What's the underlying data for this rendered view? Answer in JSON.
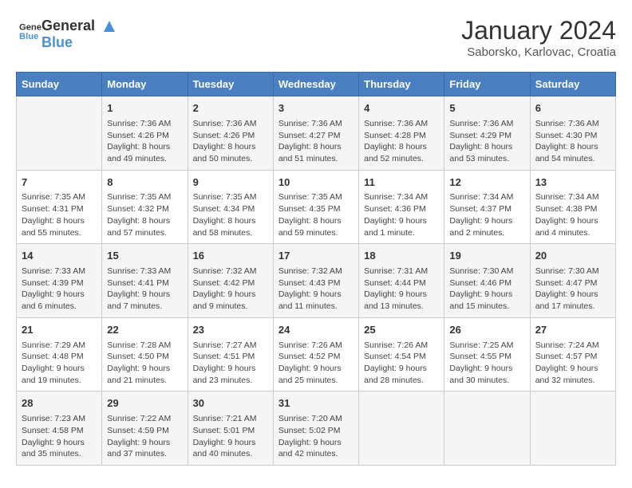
{
  "logo": {
    "line1": "General",
    "line2": "Blue"
  },
  "title": "January 2024",
  "subtitle": "Saborsko, Karlovac, Croatia",
  "headers": [
    "Sunday",
    "Monday",
    "Tuesday",
    "Wednesday",
    "Thursday",
    "Friday",
    "Saturday"
  ],
  "weeks": [
    [
      {
        "day": "",
        "content": ""
      },
      {
        "day": "1",
        "content": "Sunrise: 7:36 AM\nSunset: 4:26 PM\nDaylight: 8 hours\nand 49 minutes."
      },
      {
        "day": "2",
        "content": "Sunrise: 7:36 AM\nSunset: 4:26 PM\nDaylight: 8 hours\nand 50 minutes."
      },
      {
        "day": "3",
        "content": "Sunrise: 7:36 AM\nSunset: 4:27 PM\nDaylight: 8 hours\nand 51 minutes."
      },
      {
        "day": "4",
        "content": "Sunrise: 7:36 AM\nSunset: 4:28 PM\nDaylight: 8 hours\nand 52 minutes."
      },
      {
        "day": "5",
        "content": "Sunrise: 7:36 AM\nSunset: 4:29 PM\nDaylight: 8 hours\nand 53 minutes."
      },
      {
        "day": "6",
        "content": "Sunrise: 7:36 AM\nSunset: 4:30 PM\nDaylight: 8 hours\nand 54 minutes."
      }
    ],
    [
      {
        "day": "7",
        "content": "Sunrise: 7:35 AM\nSunset: 4:31 PM\nDaylight: 8 hours\nand 55 minutes."
      },
      {
        "day": "8",
        "content": "Sunrise: 7:35 AM\nSunset: 4:32 PM\nDaylight: 8 hours\nand 57 minutes."
      },
      {
        "day": "9",
        "content": "Sunrise: 7:35 AM\nSunset: 4:34 PM\nDaylight: 8 hours\nand 58 minutes."
      },
      {
        "day": "10",
        "content": "Sunrise: 7:35 AM\nSunset: 4:35 PM\nDaylight: 8 hours\nand 59 minutes."
      },
      {
        "day": "11",
        "content": "Sunrise: 7:34 AM\nSunset: 4:36 PM\nDaylight: 9 hours\nand 1 minute."
      },
      {
        "day": "12",
        "content": "Sunrise: 7:34 AM\nSunset: 4:37 PM\nDaylight: 9 hours\nand 2 minutes."
      },
      {
        "day": "13",
        "content": "Sunrise: 7:34 AM\nSunset: 4:38 PM\nDaylight: 9 hours\nand 4 minutes."
      }
    ],
    [
      {
        "day": "14",
        "content": "Sunrise: 7:33 AM\nSunset: 4:39 PM\nDaylight: 9 hours\nand 6 minutes."
      },
      {
        "day": "15",
        "content": "Sunrise: 7:33 AM\nSunset: 4:41 PM\nDaylight: 9 hours\nand 7 minutes."
      },
      {
        "day": "16",
        "content": "Sunrise: 7:32 AM\nSunset: 4:42 PM\nDaylight: 9 hours\nand 9 minutes."
      },
      {
        "day": "17",
        "content": "Sunrise: 7:32 AM\nSunset: 4:43 PM\nDaylight: 9 hours\nand 11 minutes."
      },
      {
        "day": "18",
        "content": "Sunrise: 7:31 AM\nSunset: 4:44 PM\nDaylight: 9 hours\nand 13 minutes."
      },
      {
        "day": "19",
        "content": "Sunrise: 7:30 AM\nSunset: 4:46 PM\nDaylight: 9 hours\nand 15 minutes."
      },
      {
        "day": "20",
        "content": "Sunrise: 7:30 AM\nSunset: 4:47 PM\nDaylight: 9 hours\nand 17 minutes."
      }
    ],
    [
      {
        "day": "21",
        "content": "Sunrise: 7:29 AM\nSunset: 4:48 PM\nDaylight: 9 hours\nand 19 minutes."
      },
      {
        "day": "22",
        "content": "Sunrise: 7:28 AM\nSunset: 4:50 PM\nDaylight: 9 hours\nand 21 minutes."
      },
      {
        "day": "23",
        "content": "Sunrise: 7:27 AM\nSunset: 4:51 PM\nDaylight: 9 hours\nand 23 minutes."
      },
      {
        "day": "24",
        "content": "Sunrise: 7:26 AM\nSunset: 4:52 PM\nDaylight: 9 hours\nand 25 minutes."
      },
      {
        "day": "25",
        "content": "Sunrise: 7:26 AM\nSunset: 4:54 PM\nDaylight: 9 hours\nand 28 minutes."
      },
      {
        "day": "26",
        "content": "Sunrise: 7:25 AM\nSunset: 4:55 PM\nDaylight: 9 hours\nand 30 minutes."
      },
      {
        "day": "27",
        "content": "Sunrise: 7:24 AM\nSunset: 4:57 PM\nDaylight: 9 hours\nand 32 minutes."
      }
    ],
    [
      {
        "day": "28",
        "content": "Sunrise: 7:23 AM\nSunset: 4:58 PM\nDaylight: 9 hours\nand 35 minutes."
      },
      {
        "day": "29",
        "content": "Sunrise: 7:22 AM\nSunset: 4:59 PM\nDaylight: 9 hours\nand 37 minutes."
      },
      {
        "day": "30",
        "content": "Sunrise: 7:21 AM\nSunset: 5:01 PM\nDaylight: 9 hours\nand 40 minutes."
      },
      {
        "day": "31",
        "content": "Sunrise: 7:20 AM\nSunset: 5:02 PM\nDaylight: 9 hours\nand 42 minutes."
      },
      {
        "day": "",
        "content": ""
      },
      {
        "day": "",
        "content": ""
      },
      {
        "day": "",
        "content": ""
      }
    ]
  ]
}
